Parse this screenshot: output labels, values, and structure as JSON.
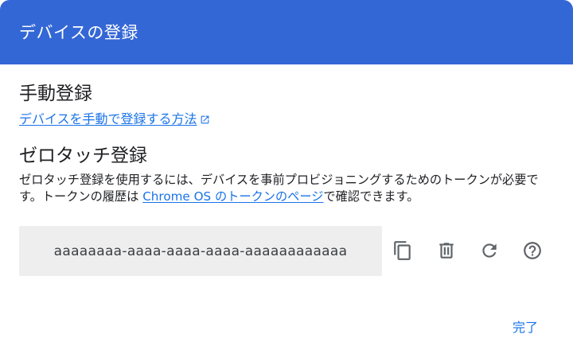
{
  "header": {
    "title": "デバイスの登録"
  },
  "manual": {
    "title": "手動登録",
    "link_label": "デバイスを手動で登録する方法",
    "link_icon": "open-in-new-icon"
  },
  "zero_touch": {
    "title": "ゼロタッチ登録",
    "description_before": "ゼロタッチ登録を使用するには、デバイスを事前プロビジョニングするためのトークンが必要です。トークンの履歴は ",
    "description_link": "Chrome OS のトークンのページ",
    "description_after": "で確認できます。",
    "token": "aaaaaaaa-aaaa-aaaa-aaaa-aaaaaaaaaaaa",
    "actions": [
      {
        "name": "copy",
        "icon": "copy-icon"
      },
      {
        "name": "delete",
        "icon": "delete-icon"
      },
      {
        "name": "refresh",
        "icon": "refresh-icon"
      },
      {
        "name": "help",
        "icon": "help-icon"
      }
    ]
  },
  "footer": {
    "done_label": "完了"
  },
  "colors": {
    "header_bg": "#3467d6",
    "link": "#1a73e8",
    "token_bg": "#eeeeee",
    "icon": "#5f6368"
  }
}
